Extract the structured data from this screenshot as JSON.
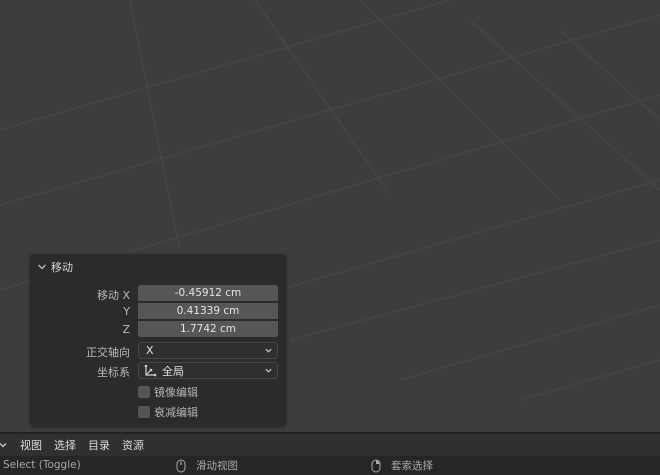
{
  "operator_panel": {
    "title": "移动",
    "move_x_label": "移动 X",
    "move_y_label": "Y",
    "move_z_label": "Z",
    "move_x_value": "-0.45912 cm",
    "move_y_value": "0.41339 cm",
    "move_z_value": "1.7742 cm",
    "orient_axis_label": "正交轴向",
    "orient_axis_value": "X",
    "coord_system_label": "坐标系",
    "coord_system_value": "全局",
    "mirror_edit_label": "镜像编辑",
    "mirror_edit_checked": false,
    "proportional_label": "衰减编辑",
    "proportional_checked": false
  },
  "header_menu": {
    "items": [
      "视图",
      "选择",
      "目录",
      "资源"
    ]
  },
  "status_bar": {
    "select_hint": "Select (Toggle)",
    "pan_hint": "滑动视图",
    "lasso_hint": "套索选择"
  },
  "colors": {
    "viewport_bg": "#3d3d3d",
    "panel_bg": "#2b2b2b",
    "field_bg": "#565656",
    "status_bg": "#262626"
  }
}
